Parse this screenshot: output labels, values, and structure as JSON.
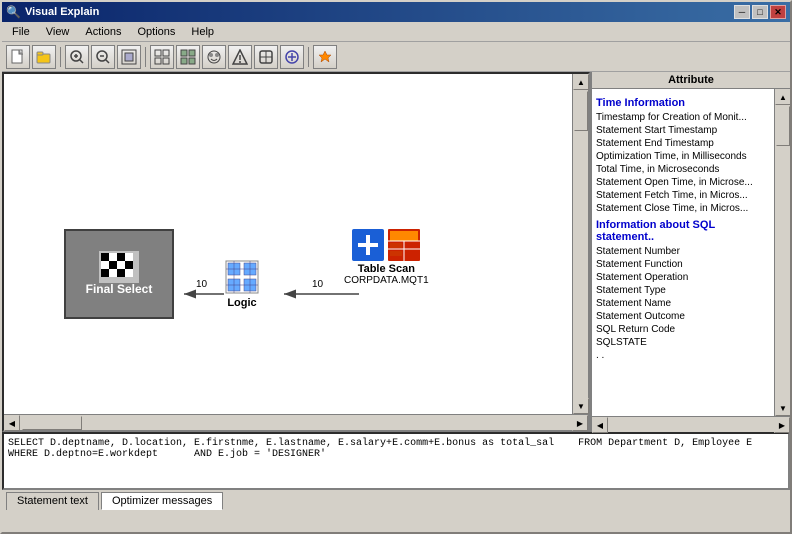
{
  "window": {
    "title": "Visual Explain",
    "icon": "🔍"
  },
  "menu": {
    "items": [
      {
        "label": "File"
      },
      {
        "label": "View"
      },
      {
        "label": "Actions"
      },
      {
        "label": "Options"
      },
      {
        "label": "Help"
      }
    ]
  },
  "toolbar": {
    "buttons": [
      {
        "name": "new",
        "icon": "📄"
      },
      {
        "name": "open",
        "icon": "📂"
      },
      {
        "name": "zoom-in",
        "icon": "🔍"
      },
      {
        "name": "zoom-out",
        "icon": "🔎"
      },
      {
        "name": "fit",
        "icon": "⊞"
      },
      {
        "name": "actual",
        "icon": "⊡"
      },
      {
        "name": "tool1",
        "icon": "⊠"
      },
      {
        "name": "tool2",
        "icon": "⊟"
      },
      {
        "name": "tool3",
        "icon": "⊞"
      },
      {
        "name": "tool4",
        "icon": "⊡"
      },
      {
        "name": "tool5",
        "icon": "⊠"
      },
      {
        "name": "tool6",
        "icon": "⊟"
      },
      {
        "name": "tool7",
        "icon": "✦"
      }
    ]
  },
  "diagram": {
    "nodes": [
      {
        "id": "final-select",
        "label": "Final Select",
        "type": "final"
      },
      {
        "id": "logic",
        "label": "Logic",
        "type": "logic"
      },
      {
        "id": "table-scan",
        "label": "Table Scan",
        "sublabel": "CORPDATA.MQT1",
        "type": "table"
      }
    ],
    "arrows": [
      {
        "from": "logic",
        "to": "final-select",
        "label": "10"
      },
      {
        "from": "table-scan",
        "to": "logic",
        "label": "10"
      }
    ]
  },
  "attributes": {
    "header": "Attribute",
    "sections": [
      {
        "title": "Time Information",
        "items": [
          "Timestamp for Creation of Monit...",
          "Statement Start Timestamp",
          "Statement End Timestamp",
          "Optimization Time, in Milliseconds",
          "Total Time, in Microseconds",
          "Statement Open Time, in Microse...",
          "Statement Fetch Time, in Micros...",
          "Statement Close Time, in Micros..."
        ]
      },
      {
        "title": "Information about SQL statement..",
        "items": [
          "Statement Number",
          "Statement Function",
          "Statement Operation",
          "Statement Type",
          "Statement Name",
          "Statement Outcome",
          "SQL Return Code",
          "SQLSTATE"
        ]
      }
    ]
  },
  "sql_text": {
    "line1": "SELECT D.deptname, D.location, E.firstnme, E.lastname, E.salary+E.comm+E.bonus as total_sal    FROM Department D, Employee E",
    "line2": "WHERE D.deptno=E.workdept      AND E.job = 'DESIGNER'"
  },
  "tabs": [
    {
      "label": "Statement text",
      "active": false
    },
    {
      "label": "Optimizer messages",
      "active": false
    }
  ],
  "titlebar": {
    "minimize": "─",
    "maximize": "□",
    "close": "✕"
  }
}
